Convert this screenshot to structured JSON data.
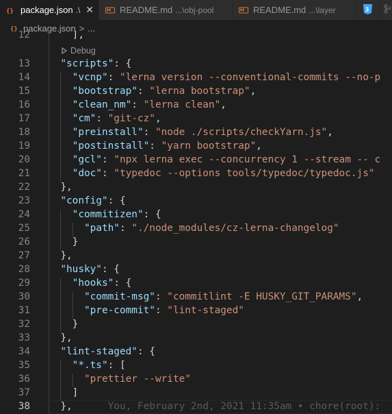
{
  "tabs": [
    {
      "label": "package.json",
      "hint": ".\\",
      "icon": "json-file-icon",
      "active": true
    },
    {
      "label": "README.md",
      "hint": "...\\obj-pool",
      "icon": "markdown-file-icon",
      "active": false
    },
    {
      "label": "README.md",
      "hint": "...\\layer",
      "icon": "markdown-file-icon",
      "active": false
    }
  ],
  "tab_overflow_icon": "css3-icon",
  "breadcrumb": {
    "file": "package.json",
    "sep": ">",
    "rest": "..."
  },
  "codelens": "Debug",
  "blame": "You, February 2nd, 2021 11:35am • chore(root):",
  "lines": [
    {
      "n": "12",
      "tokens": [
        {
          "t": "p",
          "v": "    ],"
        }
      ]
    },
    {
      "n": "13",
      "tokens": [
        {
          "t": "p",
          "v": "  "
        },
        {
          "t": "k",
          "v": "\"scripts\""
        },
        {
          "t": "p",
          "v": ": {"
        }
      ]
    },
    {
      "n": "14",
      "tokens": [
        {
          "t": "p",
          "v": "    "
        },
        {
          "t": "k",
          "v": "\"vcnp\""
        },
        {
          "t": "p",
          "v": ": "
        },
        {
          "t": "s",
          "v": "\"lerna version --conventional-commits --no-p"
        }
      ]
    },
    {
      "n": "15",
      "tokens": [
        {
          "t": "p",
          "v": "    "
        },
        {
          "t": "k",
          "v": "\"bootstrap\""
        },
        {
          "t": "p",
          "v": ": "
        },
        {
          "t": "s",
          "v": "\"lerna bootstrap\""
        },
        {
          "t": "p",
          "v": ","
        }
      ]
    },
    {
      "n": "16",
      "tokens": [
        {
          "t": "p",
          "v": "    "
        },
        {
          "t": "k",
          "v": "\"clean_nm\""
        },
        {
          "t": "p",
          "v": ": "
        },
        {
          "t": "s",
          "v": "\"lerna clean\""
        },
        {
          "t": "p",
          "v": ","
        }
      ]
    },
    {
      "n": "17",
      "tokens": [
        {
          "t": "p",
          "v": "    "
        },
        {
          "t": "k",
          "v": "\"cm\""
        },
        {
          "t": "p",
          "v": ": "
        },
        {
          "t": "s",
          "v": "\"git-cz\""
        },
        {
          "t": "p",
          "v": ","
        }
      ]
    },
    {
      "n": "18",
      "tokens": [
        {
          "t": "p",
          "v": "    "
        },
        {
          "t": "k",
          "v": "\"preinstall\""
        },
        {
          "t": "p",
          "v": ": "
        },
        {
          "t": "s",
          "v": "\"node ./scripts/checkYarn.js\""
        },
        {
          "t": "p",
          "v": ","
        }
      ]
    },
    {
      "n": "19",
      "tokens": [
        {
          "t": "p",
          "v": "    "
        },
        {
          "t": "k",
          "v": "\"postinstall\""
        },
        {
          "t": "p",
          "v": ": "
        },
        {
          "t": "s",
          "v": "\"yarn bootstrap\""
        },
        {
          "t": "p",
          "v": ","
        }
      ]
    },
    {
      "n": "20",
      "tokens": [
        {
          "t": "p",
          "v": "    "
        },
        {
          "t": "k",
          "v": "\"gcl\""
        },
        {
          "t": "p",
          "v": ": "
        },
        {
          "t": "s",
          "v": "\"npx lerna exec --concurrency 1 --stream -- c"
        }
      ]
    },
    {
      "n": "21",
      "tokens": [
        {
          "t": "p",
          "v": "    "
        },
        {
          "t": "k",
          "v": "\"doc\""
        },
        {
          "t": "p",
          "v": ": "
        },
        {
          "t": "s",
          "v": "\"typedoc --options tools/typedoc/typedoc.js\""
        }
      ]
    },
    {
      "n": "22",
      "tokens": [
        {
          "t": "p",
          "v": "  },"
        }
      ]
    },
    {
      "n": "23",
      "tokens": [
        {
          "t": "p",
          "v": "  "
        },
        {
          "t": "k",
          "v": "\"config\""
        },
        {
          "t": "p",
          "v": ": {"
        }
      ]
    },
    {
      "n": "24",
      "tokens": [
        {
          "t": "p",
          "v": "    "
        },
        {
          "t": "k",
          "v": "\"commitizen\""
        },
        {
          "t": "p",
          "v": ": {"
        }
      ]
    },
    {
      "n": "25",
      "tokens": [
        {
          "t": "p",
          "v": "      "
        },
        {
          "t": "k",
          "v": "\"path\""
        },
        {
          "t": "p",
          "v": ": "
        },
        {
          "t": "s",
          "v": "\"./node_modules/cz-lerna-changelog\""
        }
      ]
    },
    {
      "n": "26",
      "tokens": [
        {
          "t": "p",
          "v": "    }"
        }
      ]
    },
    {
      "n": "27",
      "tokens": [
        {
          "t": "p",
          "v": "  },"
        }
      ]
    },
    {
      "n": "28",
      "tokens": [
        {
          "t": "p",
          "v": "  "
        },
        {
          "t": "k",
          "v": "\"husky\""
        },
        {
          "t": "p",
          "v": ": {"
        }
      ]
    },
    {
      "n": "29",
      "tokens": [
        {
          "t": "p",
          "v": "    "
        },
        {
          "t": "k",
          "v": "\"hooks\""
        },
        {
          "t": "p",
          "v": ": {"
        }
      ]
    },
    {
      "n": "30",
      "tokens": [
        {
          "t": "p",
          "v": "      "
        },
        {
          "t": "k",
          "v": "\"commit-msg\""
        },
        {
          "t": "p",
          "v": ": "
        },
        {
          "t": "s",
          "v": "\"commitlint -E HUSKY_GIT_PARAMS\""
        },
        {
          "t": "p",
          "v": ","
        }
      ]
    },
    {
      "n": "31",
      "tokens": [
        {
          "t": "p",
          "v": "      "
        },
        {
          "t": "k",
          "v": "\"pre-commit\""
        },
        {
          "t": "p",
          "v": ": "
        },
        {
          "t": "s",
          "v": "\"lint-staged\""
        }
      ]
    },
    {
      "n": "32",
      "tokens": [
        {
          "t": "p",
          "v": "    }"
        }
      ]
    },
    {
      "n": "33",
      "tokens": [
        {
          "t": "p",
          "v": "  },"
        }
      ]
    },
    {
      "n": "34",
      "tokens": [
        {
          "t": "p",
          "v": "  "
        },
        {
          "t": "k",
          "v": "\"lint-staged\""
        },
        {
          "t": "p",
          "v": ": {"
        }
      ]
    },
    {
      "n": "35",
      "tokens": [
        {
          "t": "p",
          "v": "    "
        },
        {
          "t": "k",
          "v": "\"*.ts\""
        },
        {
          "t": "p",
          "v": ": ["
        }
      ]
    },
    {
      "n": "36",
      "tokens": [
        {
          "t": "p",
          "v": "      "
        },
        {
          "t": "s",
          "v": "\"prettier --write\""
        }
      ]
    },
    {
      "n": "37",
      "tokens": [
        {
          "t": "p",
          "v": "    ]"
        }
      ]
    },
    {
      "n": "38",
      "tokens": [
        {
          "t": "p",
          "v": "  },"
        }
      ],
      "current": true
    }
  ],
  "colors": {
    "key": "#9cdcfe",
    "string": "#ce9178",
    "punct": "#d4d4d4",
    "gutter": "#858585",
    "background": "#1e1e1e",
    "tab_inactive": "#2d2d2d"
  }
}
